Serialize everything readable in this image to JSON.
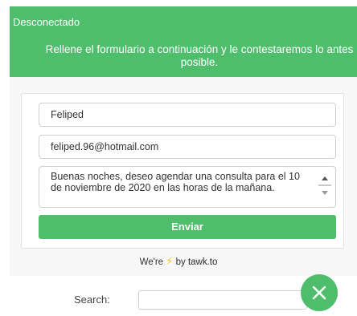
{
  "header": {
    "status": "Desconectado",
    "subtitle": "Rellene el formulario a continuación y le contestaremos lo antes posible."
  },
  "form": {
    "name_value": "Feliped",
    "email_value": "feliped.96@hotmail.com",
    "message_value": "Buenas noches, deseo agendar una consulta para el 10 de noviembre de 2020 en las horas de la mañana.",
    "send_label": "Enviar"
  },
  "footer": {
    "prefix": "We're",
    "by": "by",
    "brand": "tawk.to"
  },
  "search": {
    "label": "Search:",
    "value": ""
  },
  "icons": {
    "bolt": "lightning-bolt-icon",
    "close": "close-icon"
  },
  "colors": {
    "accent": "#4fbe6c",
    "bolt": "#f5c518"
  }
}
